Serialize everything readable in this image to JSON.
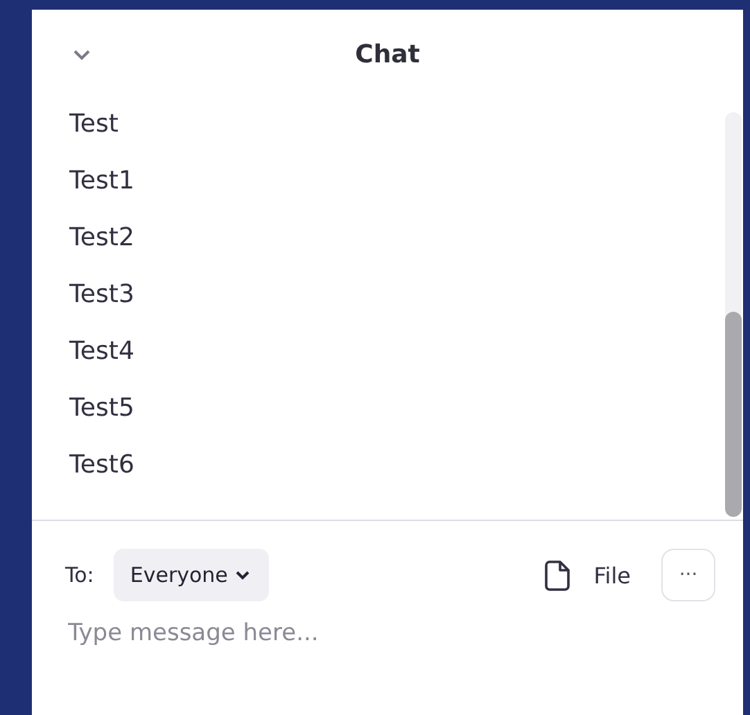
{
  "header": {
    "title": "Chat"
  },
  "messages": [
    {
      "text": "Test"
    },
    {
      "text": "Test1"
    },
    {
      "text": "Test2"
    },
    {
      "text": "Test3"
    },
    {
      "text": "Test4"
    },
    {
      "text": "Test5"
    },
    {
      "text": "Test6"
    }
  ],
  "compose": {
    "to_label": "To:",
    "recipient": "Everyone",
    "file_label": "File",
    "more_label": "···",
    "placeholder": "Type message here..."
  }
}
